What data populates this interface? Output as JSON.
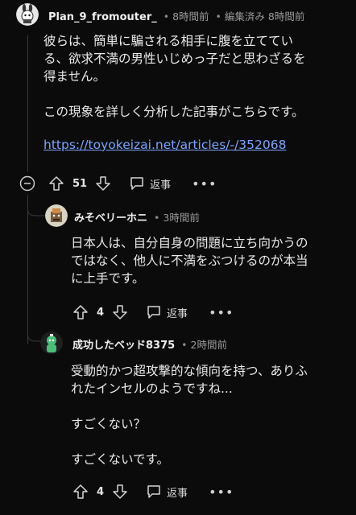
{
  "comment1": {
    "username": "Plan_9_fromouter_",
    "time": "8時間前",
    "edited": "編集済み 8時間前",
    "paragraphs": [
      "彼らは、簡単に騙される相手に腹を立ててい",
      "る、欲求不満の男性いじめっ子だと思わざるを",
      "得ません。"
    ],
    "paragraph2": "この現象を詳しく分析した記事がこちらです。",
    "link": "https://toyokeizai.net/articles/-/352068",
    "votes": "51",
    "reply_label": "返事"
  },
  "comment2": {
    "username": "みそベリーホニ",
    "time": "3時間前",
    "lines": [
      "日本人は、自分自身の問題に立ち向かうの",
      "ではなく、他人に不満をぶつけるのが本当",
      "に上手です。"
    ],
    "votes": "4",
    "reply_label": "返事"
  },
  "comment3": {
    "username": "成功したベッド8375",
    "time": "2時間前",
    "lines": [
      "受動的かつ超攻撃的な傾向を持つ、ありふ",
      "れたインセルのようですね..."
    ],
    "line2": "すごくない？",
    "line3": "すごくないです。",
    "votes": "4",
    "reply_label": "返事"
  },
  "colors": {
    "background": "#0b0b0b",
    "link": "#7aa4ff",
    "muted": "#9a9a9a"
  }
}
